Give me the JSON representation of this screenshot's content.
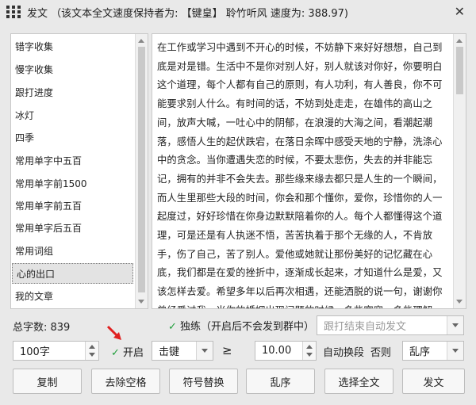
{
  "window": {
    "title": "发文 （该文本全文速度保持者为: 【键皇】 聆竹听风 速度为: 388.97)",
    "close_glyph": "✕"
  },
  "list": {
    "items": [
      "错字收集",
      "慢字收集",
      "跟打进度",
      "冰灯",
      "四季",
      "常用单字中五百",
      "常用单字前1500",
      "常用单字前五百",
      "常用单字后五百",
      "常用词组",
      "心的出口",
      "我的文章"
    ],
    "selected_index": 10
  },
  "article": {
    "text": "在工作或学习中遇到不开心的时候，不妨静下来好好想想，自己到底是对是错。生活中不是你对别人好，别人就该对你好，你要明白这个道理，每个人都有自己的原则，有人功利，有人善良，你不可能要求别人什么。有时间的话，不妨到处走走，在雄伟的高山之间，放声大喊，一吐心中的阴郁，在浪漫的大海之间，看潮起潮落，感悟人生的起伏跌宕，在落日余晖中感受天地的宁静，洗涤心中的贪念。当你遭遇失恋的时候，不要太悲伤，失去的并非能忘记，拥有的并非不会失去。那些缘来缘去都只是人生的一个瞬间，而人生里那些大段的时间，你会和那个懂你，爱你，珍惜你的人一起度过，好好珍惜在你身边默默陪着你的人。每个人都懂得这个道理，可是还是有人执迷不悟，苦苦执着于那个无缘的人，不肯放手，伤了自己，苦了别人。爱他或她就让那份美好的记忆藏在心底，我们都是在爱的挫折中，逐渐成长起来，才知道什么是爱，又该怎样去爱。希望多年以后再次相遇，还能洒脱的说一句，谢谢你曾经爱过我。当你的婚姻出现问题的时候，多些宽容，多些理解，少些责骂。婚姻本来就是两个人的事，一味的埋怨对方，根本不能解决任何问题。多想想曾经的美好回忆，想想两人同吃一碗面的艰难日子，想想曾经心里的感动。试着做一下换位思考，自己错在哪"
  },
  "status": {
    "word_count": "总字数: 839",
    "solo_check": "✓",
    "solo_label": "独练（开启后不会发到群中）",
    "auto_send_placeholder": "跟打结束自动发文"
  },
  "controls": {
    "chars": "100字",
    "open_check": "✓",
    "open_label": "开启",
    "mode": "击键",
    "gte": "≥",
    "threshold": "10.00",
    "auto_change": "自动换段",
    "otherwise": "否则",
    "order": "乱序"
  },
  "buttons": [
    "复制",
    "去除空格",
    "符号替换",
    "乱序",
    "选择全文",
    "发文"
  ]
}
